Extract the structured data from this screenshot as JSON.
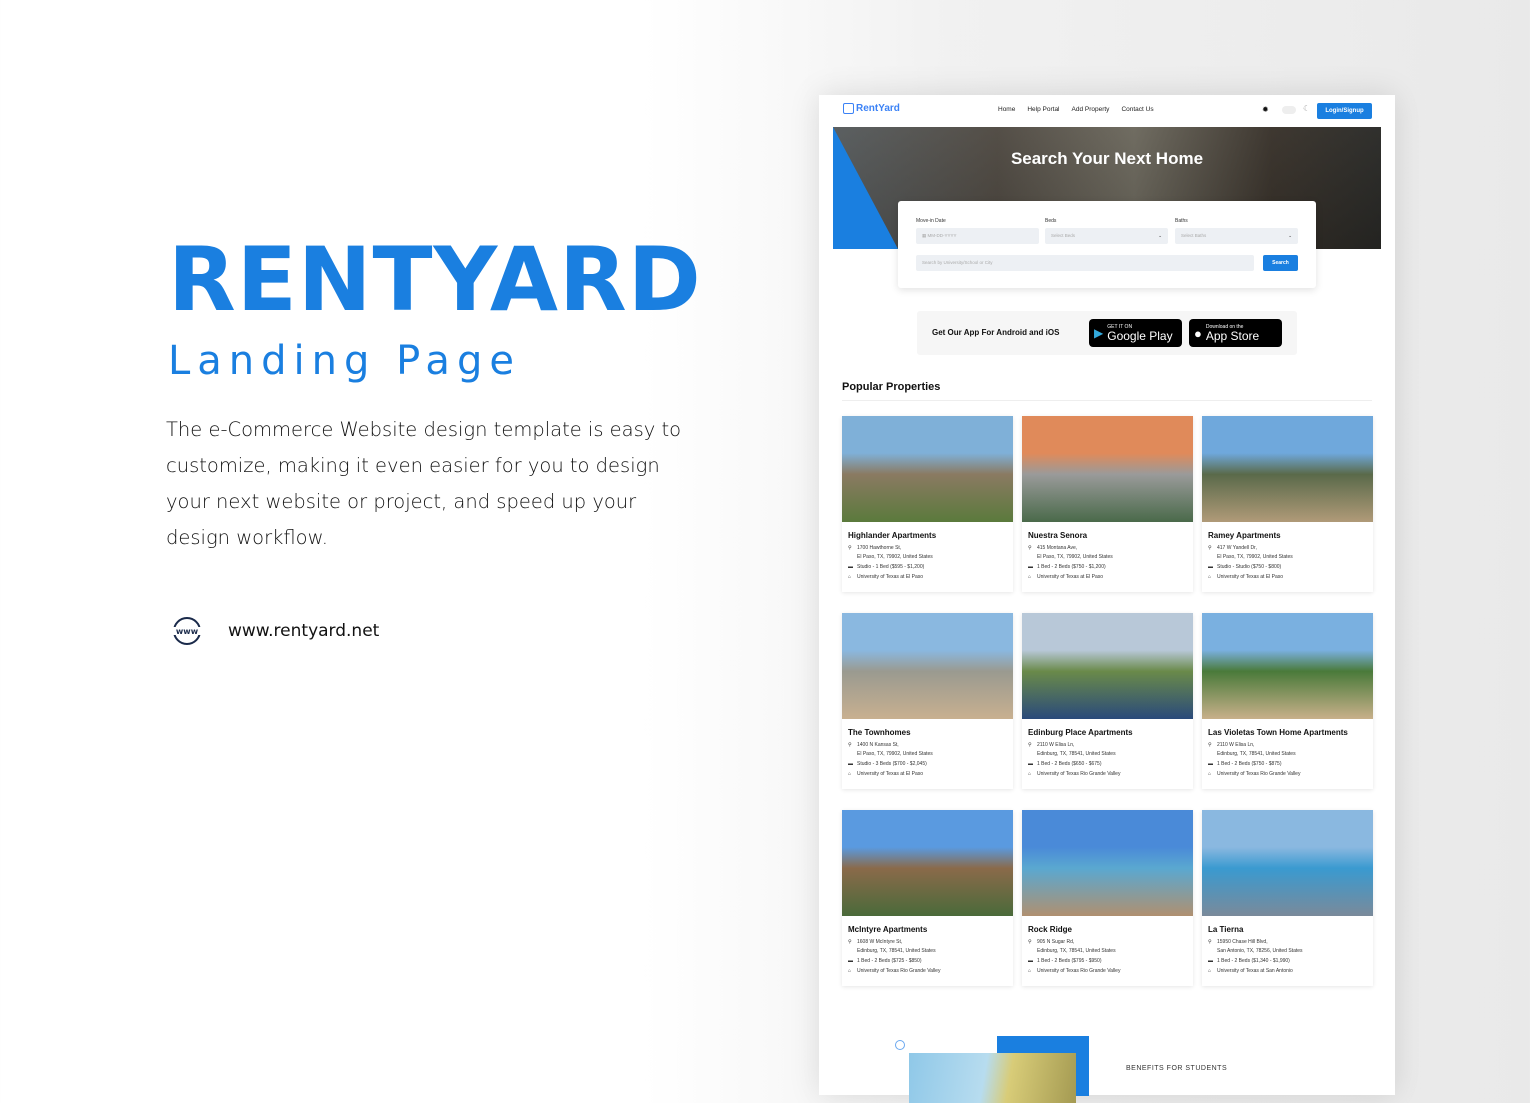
{
  "left": {
    "title": "RENTYARD",
    "subtitle": "Landing Page",
    "description": "The e-Commerce Website design template is easy to customize, making it even easier for you to design your next website or project, and speed up your design workflow.",
    "url": "www.rentyard.net",
    "www_icon": "globe-www-icon"
  },
  "nav": {
    "logo": "RentYard",
    "links": [
      "Home",
      "Help Portal",
      "Add Property",
      "Contact Us"
    ],
    "login": "Login/Signup"
  },
  "hero": {
    "title": "Search Your Next Home",
    "move_in_label": "Move-in Date",
    "move_in_placeholder": "MM-DD-YYYY",
    "beds_label": "Beds",
    "beds_placeholder": "Select Beds",
    "baths_label": "Baths",
    "baths_placeholder": "Select Baths",
    "search_placeholder": "Search by University/School or City",
    "search_button": "Search",
    "accent": "#1a7fe0"
  },
  "app": {
    "text": "Get Our App For Android and iOS",
    "google_small": "GET IT ON",
    "google_big": "Google Play",
    "apple_small": "Download on the",
    "apple_big": "App Store"
  },
  "popular": {
    "title": "Popular Properties",
    "items": [
      {
        "name": "Highlander Apartments",
        "addr1": "1700 Hawthorne St,",
        "addr2": "El Paso, TX, 79902, United States",
        "beds": "Studio - 1 Bed ($595 - $1,200)",
        "school": "University of Texas at El Paso",
        "img": [
          "#7fb0d8",
          "#5b7a3c",
          "#8a7a62"
        ]
      },
      {
        "name": "Nuestra Senora",
        "addr1": "415 Montana Ave,",
        "addr2": "El Paso, TX, 79902, United States",
        "beds": "1 Bed - 2 Beds ($750 - $1,200)",
        "school": "University of Texas at El Paso",
        "img": [
          "#e08a5a",
          "#4a6a4a",
          "#9a9a9a"
        ]
      },
      {
        "name": "Ramey Apartments",
        "addr1": "417 W Yandell Dr,",
        "addr2": "El Paso, TX, 79902, United States",
        "beds": "Studio - Studio ($750 - $800)",
        "school": "University of Texas at El Paso",
        "img": [
          "#6fa8dc",
          "#b09a78",
          "#5a6a4a"
        ]
      },
      {
        "name": "The Townhomes",
        "addr1": "1400 N Kansas St,",
        "addr2": "El Paso, TX, 79902, United States",
        "beds": "Studio - 3 Beds ($700 - $2,045)",
        "school": "University of Texas at El Paso",
        "img": [
          "#8ab8e0",
          "#c8b090",
          "#9a9a90"
        ]
      },
      {
        "name": "Edinburg Place Apartments",
        "addr1": "2110 W Elisa Ln,",
        "addr2": "Edinburg, TX, 78541, United States",
        "beds": "1 Bed - 2 Beds ($650 - $675)",
        "school": "University of Texas Rio Grande Valley",
        "img": [
          "#b8c8d8",
          "#2a4a7a",
          "#6a8a4a"
        ]
      },
      {
        "name": "Las Violetas Town Home Apartments",
        "addr1": "2110 W Elisa Ln,",
        "addr2": "Edinburg, TX, 78541, United States",
        "beds": "1 Bed - 2 Beds ($750 - $875)",
        "school": "University of Texas Rio Grande Valley",
        "img": [
          "#7ab0e0",
          "#c8b08a",
          "#4a7a3a"
        ]
      },
      {
        "name": "McIntyre Apartments",
        "addr1": "1608 W McIntyre St,",
        "addr2": "Edinburg, TX, 78541, United States",
        "beds": "1 Bed - 2 Beds ($725 - $850)",
        "school": "University of Texas Rio Grande Valley",
        "img": [
          "#5a9ae0",
          "#4a6a3a",
          "#8a6a4a"
        ]
      },
      {
        "name": "Rock Ridge",
        "addr1": "905 N Sugar Rd,",
        "addr2": "Edinburg, TX, 78541, United States",
        "beds": "1 Bed - 2 Beds ($795 - $950)",
        "school": "University of Texas Rio Grande Valley",
        "img": [
          "#4a8ad8",
          "#b09070",
          "#5aa8d0"
        ]
      },
      {
        "name": "La Tierna",
        "addr1": "15950 Chase Hill Blvd,",
        "addr2": "San Antonio, TX, 78256, United States",
        "beds": "1 Bed - 2 Beds ($1,340 - $1,990)",
        "school": "University of Texas at San Antonio",
        "img": [
          "#8ab8e0",
          "#7a8a9a",
          "#3a9ad0"
        ]
      }
    ]
  },
  "benefits": {
    "label": "BENEFITS FOR STUDENTS"
  }
}
